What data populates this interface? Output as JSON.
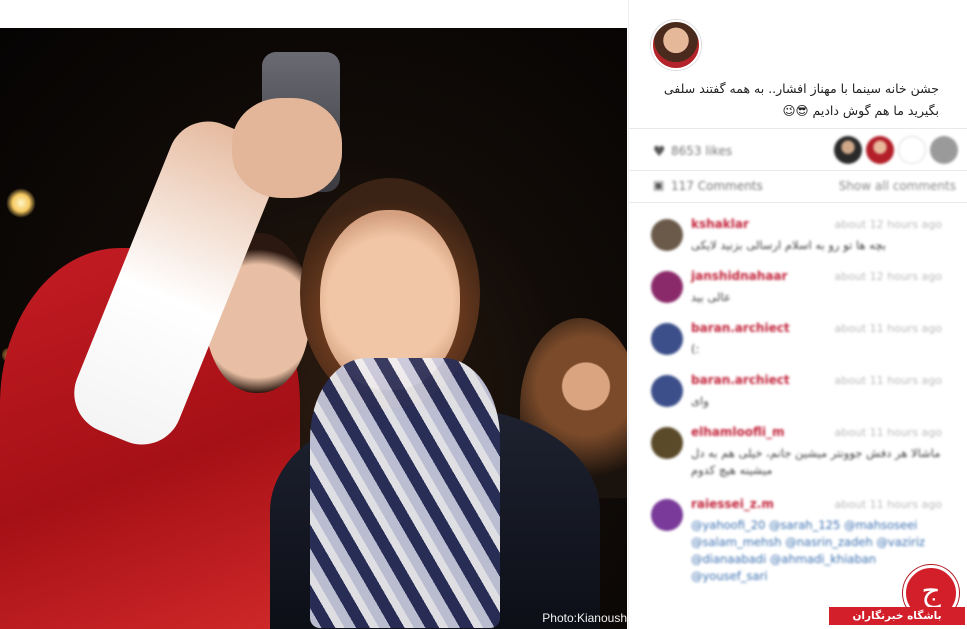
{
  "post": {
    "caption": "جشن خانه سینما با مهناز افشار.. به همه گفتند سلفی بگیرید ما هم گوش دادیم 😎😉",
    "photo_credit": "Photo:Kianoush"
  },
  "stats": {
    "likes_icon": "heart-icon",
    "likes_text": "8653 likes",
    "comments_icon": "comment-icon",
    "comments_text": "117 Comments",
    "show_all": "Show all comments"
  },
  "colors": {
    "username": "#c2233a",
    "mention": "#3a6fb0",
    "watermark_red": "#d21f2a"
  },
  "comments": [
    {
      "user": "kshaklar",
      "time": "about 12 hours ago",
      "text": "بچه ها تو رو به اسلام ارسالی بزنید لایکی",
      "avatar": "#6b5a4a"
    },
    {
      "user": "janshidnahaar",
      "time": "about 12 hours ago",
      "text": "عالی بید",
      "avatar": "#8b2a6a"
    },
    {
      "user": "baran.archiect",
      "time": "about 11 hours ago",
      "text": ":)",
      "avatar": "#3c4f8a"
    },
    {
      "user": "baran.archiect",
      "time": "about 11 hours ago",
      "text": "وای",
      "avatar": "#3c4f8a"
    },
    {
      "user": "elhamloofli_m",
      "time": "about 11 hours ago",
      "text": "ماشالا هر دفش جوونتر میشین جانم، خیلی هم به دل میشینه هیچ کدوم",
      "avatar": "#5a4a2a"
    },
    {
      "user": "raiessei_z.m",
      "time": "about 11 hours ago",
      "text": "@yahoofi_20 @sarah_125 @mahsoseei @salam_mehsh @nasrin_zadeh @vaziriz @dianaabadi @ahmadi_khiaban @yousef_sari",
      "avatar": "#7a3a9a",
      "mention": true
    }
  ],
  "watermark": {
    "glyph": "ج",
    "text": "باشگاه خبرنگاران"
  }
}
